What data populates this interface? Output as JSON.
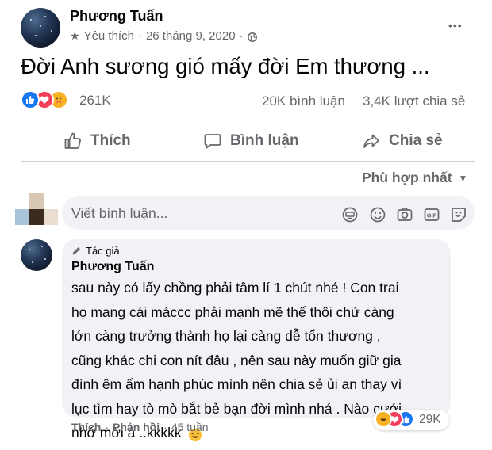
{
  "post": {
    "author": "Phương Tuấn",
    "favorite_label": "Yêu thích",
    "date": "26 tháng 9, 2020",
    "separator": "·",
    "text": "Đời Anh sương gió mấy đời Em thương ...",
    "more_label": "•••"
  },
  "stats": {
    "reactions_count": "261K",
    "comments": "20K bình luận",
    "shares": "3,4K lượt chia sẻ",
    "reaction_types": [
      "like",
      "love",
      "care"
    ]
  },
  "actions": {
    "like": "Thích",
    "comment": "Bình luận",
    "share": "Chia sẻ"
  },
  "sort": {
    "label": "Phù hợp nhất"
  },
  "composer": {
    "placeholder": "Viết bình luận...",
    "icons": [
      "sticker-icon",
      "emoji-icon",
      "camera-icon",
      "gif-icon",
      "avatar-sticker-icon"
    ]
  },
  "comment": {
    "badge": "Tác giả",
    "author": "Phương Tuấn",
    "lines": [
      "sau này có lấy chồng phải tâm lí 1 chút nhé ! Con trai",
      "họ mang cái máccc phải mạnh mẽ thế thôi chứ càng",
      "lớn càng trưởng thành họ lại càng dễ tổn thương ,",
      "cũng khác chi con nít đâu , nên sau này muốn giữ gia",
      "đình êm ấm hạnh phúc mình nên chia sẻ ủi an thay vì",
      "lục tìm hay tò mò bắt bẻ bạn đời mình nhá . Nào cưới",
      "nhớ mời á ..kkkkk"
    ],
    "reactions_count": "29K",
    "like": "Thích",
    "reply": "Phản hồi",
    "time": "45 tuần",
    "dot": "·"
  },
  "colors": {
    "like_blue": "#1877f2",
    "love_red": "#f33e58",
    "care_yellow": "#f7b125",
    "muted": "#65676b",
    "bubble": "#f0f2f5"
  }
}
